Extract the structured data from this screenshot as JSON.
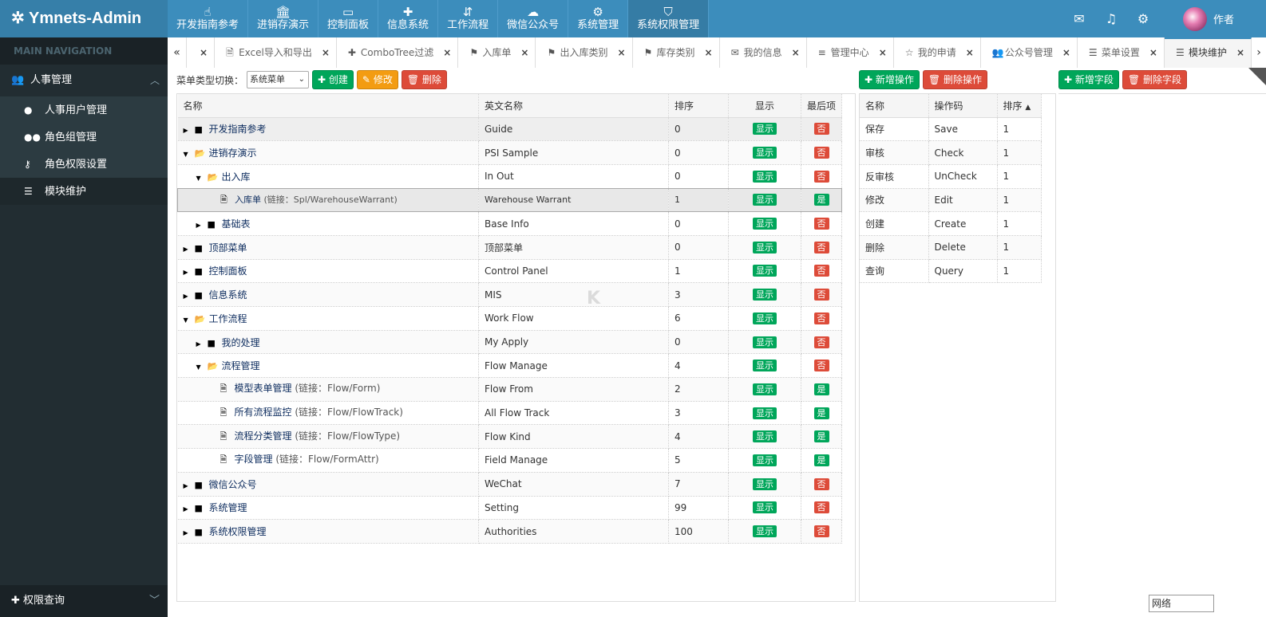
{
  "app": {
    "title": "Ymnets-Admin"
  },
  "topnav": [
    {
      "label": "开发指南参考",
      "icon": "hand-pointer-icon"
    },
    {
      "label": "进销存演示",
      "icon": "bank-icon"
    },
    {
      "label": "控制面板",
      "icon": "monitor-icon"
    },
    {
      "label": "信息系统",
      "icon": "puzzle-icon"
    },
    {
      "label": "工作流程",
      "icon": "sort-icon"
    },
    {
      "label": "微信公众号",
      "icon": "wechat-icon"
    },
    {
      "label": "系统管理",
      "icon": "gears-icon"
    },
    {
      "label": "系统权限管理",
      "icon": "shield-icon"
    }
  ],
  "header_right": {
    "user": "作者"
  },
  "sidebar": {
    "heading": "MAIN NAVIGATION",
    "group": "人事管理",
    "items": [
      "人事用户管理",
      "角色组管理",
      "角色权限设置",
      "模块维护"
    ],
    "bottom": "权限查询"
  },
  "tabs": [
    {
      "label": "",
      "icon": ""
    },
    {
      "label": "Excel导入和导出",
      "icon": "file-icon"
    },
    {
      "label": "ComboTree过滤",
      "icon": "puzzle-icon"
    },
    {
      "label": "入库单",
      "icon": "flag-icon"
    },
    {
      "label": "出入库类别",
      "icon": "flag-icon"
    },
    {
      "label": "库存类别",
      "icon": "flag-icon"
    },
    {
      "label": "我的信息",
      "icon": "envelope-icon"
    },
    {
      "label": "管理中心",
      "icon": "align-icon"
    },
    {
      "label": "我的申请",
      "icon": "star-icon"
    },
    {
      "label": "公众号管理",
      "icon": "users-icon"
    },
    {
      "label": "菜单设置",
      "icon": "list-icon"
    },
    {
      "label": "模块维护",
      "icon": "list-icon"
    }
  ],
  "toolbar1": {
    "switch_label": "菜单类型切换：",
    "select_value": "系统菜单",
    "create": "创建",
    "edit": "修改",
    "delete": "删除"
  },
  "grid1": {
    "columns": [
      "名称",
      "英文名称",
      "排序",
      "显示",
      "最后项"
    ],
    "rows": [
      {
        "name": "开发指南参考",
        "link": "",
        "en": "Guide",
        "sort": "0",
        "show": "显示",
        "last": "否",
        "level": 0,
        "type": "folder",
        "open": false
      },
      {
        "name": "进销存演示",
        "link": "",
        "en": "PSI Sample",
        "sort": "0",
        "show": "显示",
        "last": "否",
        "level": 0,
        "type": "folder",
        "open": true
      },
      {
        "name": "出入库",
        "link": "",
        "en": "In Out",
        "sort": "0",
        "show": "显示",
        "last": "否",
        "level": 1,
        "type": "folder",
        "open": true
      },
      {
        "name": "入库单",
        "link": "(链接：Spl/WarehouseWarrant)",
        "en": "Warehouse Warrant",
        "sort": "1",
        "show": "显示",
        "last": "是",
        "level": 2,
        "type": "file"
      },
      {
        "name": "基础表",
        "link": "",
        "en": "Base Info",
        "sort": "0",
        "show": "显示",
        "last": "否",
        "level": 1,
        "type": "folder",
        "open": false
      },
      {
        "name": "顶部菜单",
        "link": "",
        "en": "顶部菜单",
        "sort": "0",
        "show": "显示",
        "last": "否",
        "level": 0,
        "type": "folder",
        "open": false
      },
      {
        "name": "控制面板",
        "link": "",
        "en": "Control Panel",
        "sort": "1",
        "show": "显示",
        "last": "否",
        "level": 0,
        "type": "folder",
        "open": false
      },
      {
        "name": "信息系统",
        "link": "",
        "en": "MIS",
        "sort": "3",
        "show": "显示",
        "last": "否",
        "level": 0,
        "type": "folder",
        "open": false
      },
      {
        "name": "工作流程",
        "link": "",
        "en": "Work Flow",
        "sort": "6",
        "show": "显示",
        "last": "否",
        "level": 0,
        "type": "folder",
        "open": true
      },
      {
        "name": "我的处理",
        "link": "",
        "en": "My Apply",
        "sort": "0",
        "show": "显示",
        "last": "否",
        "level": 1,
        "type": "folder",
        "open": false
      },
      {
        "name": "流程管理",
        "link": "",
        "en": "Flow Manage",
        "sort": "4",
        "show": "显示",
        "last": "否",
        "level": 1,
        "type": "folder",
        "open": true
      },
      {
        "name": "模型表单管理",
        "link": "(链接：Flow/Form)",
        "en": "Flow From",
        "sort": "2",
        "show": "显示",
        "last": "是",
        "level": 2,
        "type": "file"
      },
      {
        "name": "所有流程监控",
        "link": "(链接：Flow/FlowTrack)",
        "en": "All Flow Track",
        "sort": "3",
        "show": "显示",
        "last": "是",
        "level": 2,
        "type": "file"
      },
      {
        "name": "流程分类管理",
        "link": "(链接：Flow/FlowType)",
        "en": "Flow Kind",
        "sort": "4",
        "show": "显示",
        "last": "是",
        "level": 2,
        "type": "file"
      },
      {
        "name": "字段管理",
        "link": "(链接：Flow/FormAttr)",
        "en": "Field Manage",
        "sort": "5",
        "show": "显示",
        "last": "是",
        "level": 2,
        "type": "file"
      },
      {
        "name": "微信公众号",
        "link": "",
        "en": "WeChat",
        "sort": "7",
        "show": "显示",
        "last": "否",
        "level": 0,
        "type": "folder",
        "open": false
      },
      {
        "name": "系统管理",
        "link": "",
        "en": "Setting",
        "sort": "99",
        "show": "显示",
        "last": "否",
        "level": 0,
        "type": "folder",
        "open": false
      },
      {
        "name": "系统权限管理",
        "link": "",
        "en": "Authorities",
        "sort": "100",
        "show": "显示",
        "last": "否",
        "level": 0,
        "type": "folder",
        "open": false
      }
    ]
  },
  "toolbar2": {
    "add": "新增操作",
    "delete": "删除操作"
  },
  "grid2": {
    "columns": [
      "名称",
      "操作码",
      "排序"
    ],
    "rows": [
      {
        "name": "保存",
        "code": "Save",
        "sort": "1"
      },
      {
        "name": "审核",
        "code": "Check",
        "sort": "1"
      },
      {
        "name": "反审核",
        "code": "UnCheck",
        "sort": "1"
      },
      {
        "name": "修改",
        "code": "Edit",
        "sort": "1"
      },
      {
        "name": "创建",
        "code": "Create",
        "sort": "1"
      },
      {
        "name": "删除",
        "code": "Delete",
        "sort": "1"
      },
      {
        "name": "查询",
        "code": "Query",
        "sort": "1"
      }
    ]
  },
  "toolbar3": {
    "add": "新增字段",
    "delete": "删除字段"
  },
  "status": {
    "network": "网络"
  },
  "colors": {
    "header": "#3c8dbc",
    "sidebar": "#222d32",
    "green": "#00a65a",
    "red": "#dd4b39",
    "yellow": "#f39c12"
  }
}
